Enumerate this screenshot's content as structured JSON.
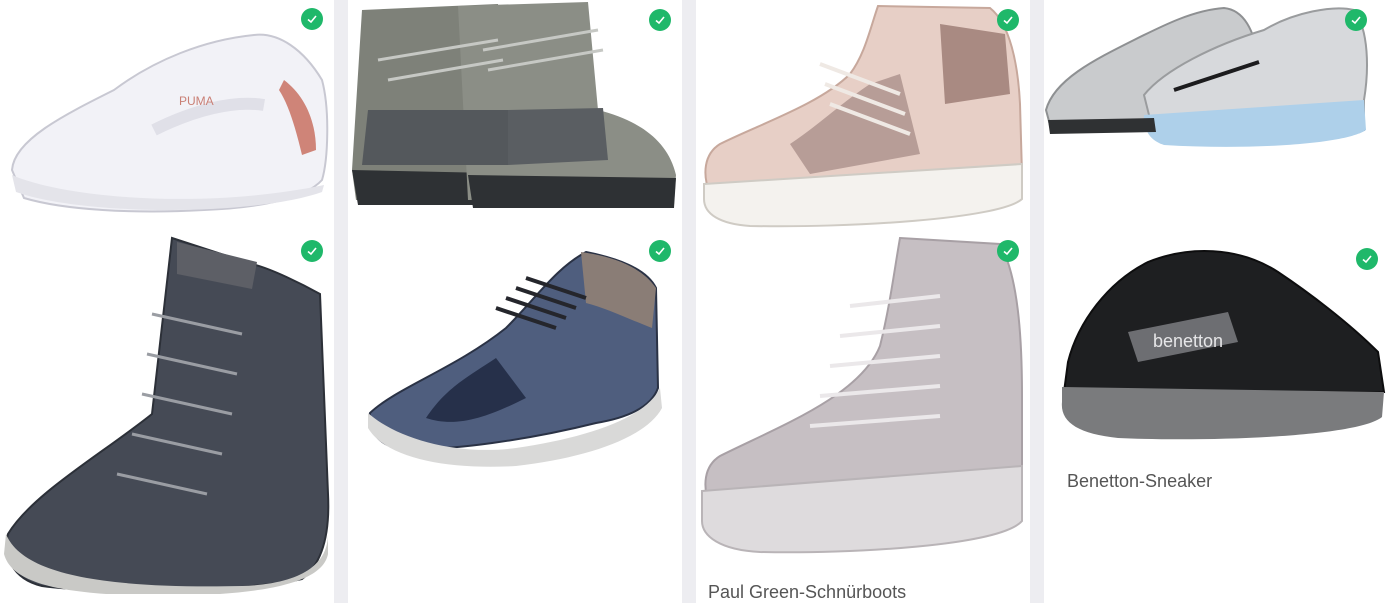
{
  "products": [
    {
      "name": "",
      "image": "white-puma-sneaker"
    },
    {
      "name": "",
      "image": "grey-sorel-snow-boot"
    },
    {
      "name": "",
      "image": "pink-bugatti-high-top"
    },
    {
      "name": "",
      "image": "grey-nike-sneaker"
    },
    {
      "name": "",
      "image": "black-kacper-leather-boot"
    },
    {
      "name": "",
      "image": "blue-rieker-ankle-sneaker"
    },
    {
      "name": "Paul Green-Schnürboots",
      "image": "lilac-lace-up-boot"
    },
    {
      "name": "Benetton-Sneaker",
      "image": "black-benetton-sneaker"
    }
  ],
  "colors": {
    "check": "#1fb86a",
    "page_bg": "#ededf1",
    "card_bg": "#ffffff",
    "title": "#555555"
  },
  "icons": {
    "select": "checkmark-icon"
  }
}
